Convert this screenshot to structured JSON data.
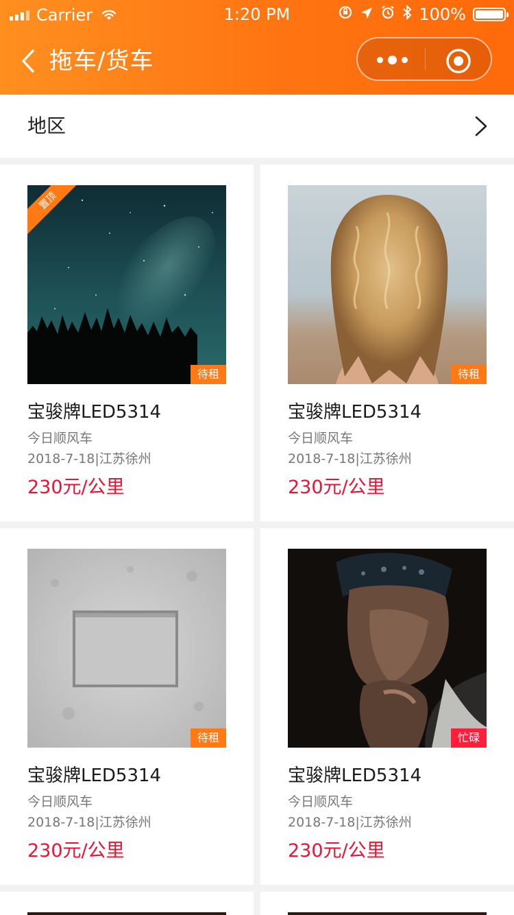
{
  "status_bar": {
    "carrier": "Carrier",
    "time": "1:20 PM",
    "battery": "100%",
    "battery_level": 1.0
  },
  "nav": {
    "title": "拖车/货车"
  },
  "filter": {
    "label": "地区"
  },
  "colors": {
    "header": "#ff7412",
    "price": "#ee1133",
    "tag_available": "#ff7a14",
    "tag_busy": "#ff1f3b"
  },
  "cards": [
    {
      "image": "night-sky-forest",
      "pinned_label": "置顶",
      "status": "待租",
      "status_type": "available",
      "title": "宝骏牌LED5314",
      "subtitle": "今日顺风车",
      "meta": "2018-7-18|江苏徐州",
      "price": "230元/公里"
    },
    {
      "image": "curly-blonde-hair",
      "pinned_label": "",
      "status": "待租",
      "status_type": "available",
      "title": "宝骏牌LED5314",
      "subtitle": "今日顺风车",
      "meta": "2018-7-18|江苏徐州",
      "price": "230元/公里"
    },
    {
      "image": "concrete-wall-frame",
      "pinned_label": "",
      "status": "待租",
      "status_type": "available",
      "title": "宝骏牌LED5314",
      "subtitle": "今日顺风车",
      "meta": "2018-7-18|江苏徐州",
      "price": "230元/公里"
    },
    {
      "image": "man-portrait-dark",
      "pinned_label": "",
      "status": "忙碌",
      "status_type": "busy",
      "title": "宝骏牌LED5314",
      "subtitle": "今日顺风车",
      "meta": "2018-7-18|江苏徐州",
      "price": "230元/公里"
    }
  ]
}
